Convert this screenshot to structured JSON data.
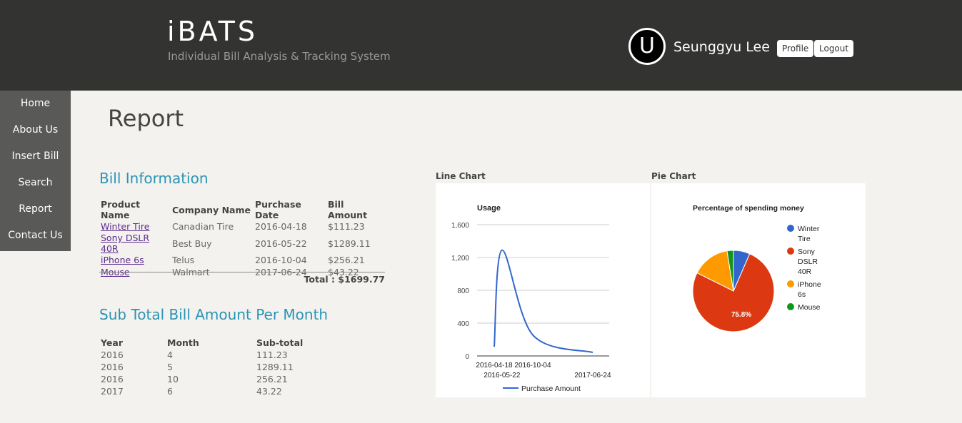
{
  "header": {
    "title": "iBATS",
    "subtitle": "Individual Bill Analysis & Tracking System",
    "avatar_letter": "U",
    "user_name": "Seunggyu Lee",
    "profile_label": "Profile",
    "logout_label": "Logout"
  },
  "sidebar": {
    "items": [
      {
        "label": "Home"
      },
      {
        "label": "About Us"
      },
      {
        "label": "Insert Bill"
      },
      {
        "label": "Search"
      },
      {
        "label": "Report"
      },
      {
        "label": "Contact Us"
      }
    ]
  },
  "page": {
    "title": "Report"
  },
  "bill_info": {
    "title": "Bill Information",
    "columns": [
      "Product Name",
      "Company Name",
      "Purchase Date",
      "Bill Amount"
    ],
    "rows": [
      [
        "Winter Tire",
        "Canadian Tire",
        "2016-04-18",
        "$111.23"
      ],
      [
        "Sony DSLR 40R",
        "Best Buy",
        "2016-05-22",
        "$1289.11"
      ],
      [
        "iPhone 6s",
        "Telus",
        "2016-10-04",
        "$256.21"
      ],
      [
        "Mouse",
        "Walmart",
        "2017-06-24",
        "$43.22"
      ]
    ],
    "total": "Total : $1699.77"
  },
  "subtotal": {
    "title": "Sub Total Bill Amount Per Month",
    "columns": [
      "Year",
      "Month",
      "Sub-total"
    ],
    "rows": [
      [
        "2016",
        "4",
        "111.23"
      ],
      [
        "2016",
        "5",
        "1289.11"
      ],
      [
        "2016",
        "10",
        "256.21"
      ],
      [
        "2017",
        "6",
        "43.22"
      ]
    ]
  },
  "charts_heads": {
    "line": "Line Chart",
    "pie": "Pie Chart"
  },
  "chart_data": [
    {
      "type": "line",
      "title": "Usage",
      "x": [
        "2016-04-18",
        "2016-05-22",
        "2016-10-04",
        "2017-06-24"
      ],
      "series": [
        {
          "name": "Purchase Amount",
          "values": [
            111.23,
            1289.11,
            256.21,
            43.22
          ],
          "color": "#3366cc"
        }
      ],
      "yticks": [
        "0",
        "400",
        "800",
        "1,200",
        "1,600"
      ],
      "ylim": [
        0,
        1600
      ],
      "grid": true,
      "legend": "bottom"
    },
    {
      "type": "pie",
      "title": "Percentage of spending money",
      "slices": [
        {
          "label": "Winter Tire",
          "value": 111.23,
          "color": "#3366cc"
        },
        {
          "label": "Sony DSLR 40R",
          "value": 1289.11,
          "color": "#dc3912"
        },
        {
          "label": "iPhone 6s",
          "value": 256.21,
          "color": "#ff9900"
        },
        {
          "label": "Mouse",
          "value": 43.22,
          "color": "#109618"
        }
      ],
      "slice_label": "75.8%",
      "legend": "right"
    }
  ]
}
